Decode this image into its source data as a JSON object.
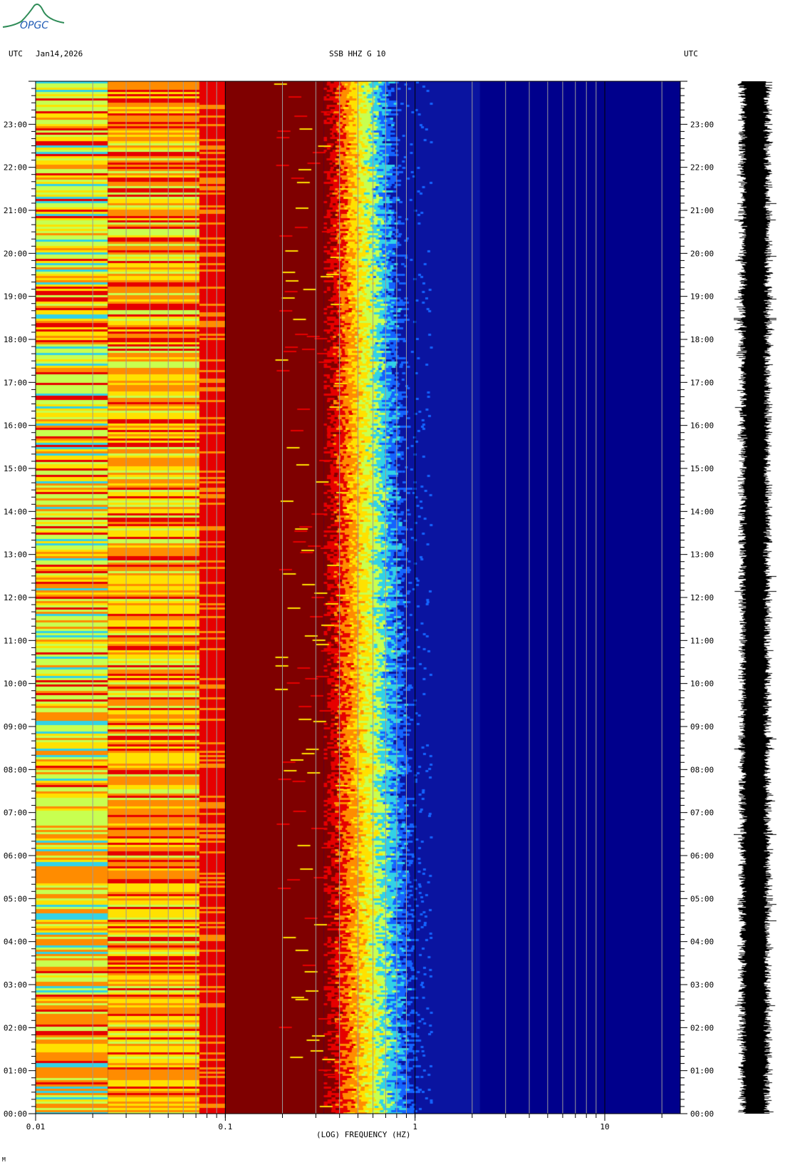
{
  "header": {
    "logo_text": "OPGC",
    "utc_left": "UTC",
    "date": "Jan14,2026",
    "station": "SSB HHZ G 10",
    "utc_right": "UTC"
  },
  "footer_mark": "M",
  "colors": {
    "background": "#ffffff",
    "dark_red": "#7f0000",
    "red": "#e60000",
    "orange": "#ff8c00",
    "yellow": "#ffe100",
    "yellow_green": "#c8ff50",
    "cyan": "#32d2e6",
    "light_blue": "#1464ff",
    "dark_blue": "#0a14a0",
    "navy": "#00008c",
    "grid_line": "#9a9a9a",
    "trace": "#000000"
  },
  "chart_data": [
    {
      "type": "heatmap",
      "title": "SSB HHZ G 10",
      "xlabel": "(LOG) FREQUENCY (HZ)",
      "ylabel": "UTC",
      "x_scale": "log",
      "xlim": [
        0.01,
        25
      ],
      "ylim": [
        "00:00",
        "24:00"
      ],
      "x_ticks": [
        "0.01",
        "0.1",
        "1",
        "10"
      ],
      "y_ticks": [
        "00:00",
        "01:00",
        "02:00",
        "03:00",
        "04:00",
        "05:00",
        "06:00",
        "07:00",
        "08:00",
        "09:00",
        "10:00",
        "11:00",
        "12:00",
        "13:00",
        "14:00",
        "15:00",
        "16:00",
        "17:00",
        "18:00",
        "19:00",
        "20:00",
        "21:00",
        "22:00",
        "23:00"
      ],
      "grid": true,
      "colormap": [
        "dark_blue",
        "light_blue",
        "cyan",
        "yellow_green",
        "yellow",
        "orange",
        "red",
        "dark_red"
      ],
      "bands": [
        {
          "freq_range": [
            0.01,
            0.024
          ],
          "level": "yellow / green / orange, red toward early hours"
        },
        {
          "freq_range": [
            0.024,
            0.073
          ],
          "level": "orange / yellow / red"
        },
        {
          "freq_range": [
            0.073,
            0.1
          ],
          "level": "red"
        },
        {
          "freq_range": [
            0.1,
            0.33
          ],
          "level": "dark red (maximum)"
        },
        {
          "freq_range": [
            0.33,
            0.9
          ],
          "level": "transition red to yellow to cyan to blue"
        },
        {
          "freq_range": [
            0.9,
            25
          ],
          "level": "dark blue (low)"
        }
      ]
    },
    {
      "type": "line",
      "name": "seismogram",
      "xlim": [
        "00:00",
        "24:00"
      ],
      "description_level": "continuous noise trace, amplitude roughly constant"
    }
  ]
}
